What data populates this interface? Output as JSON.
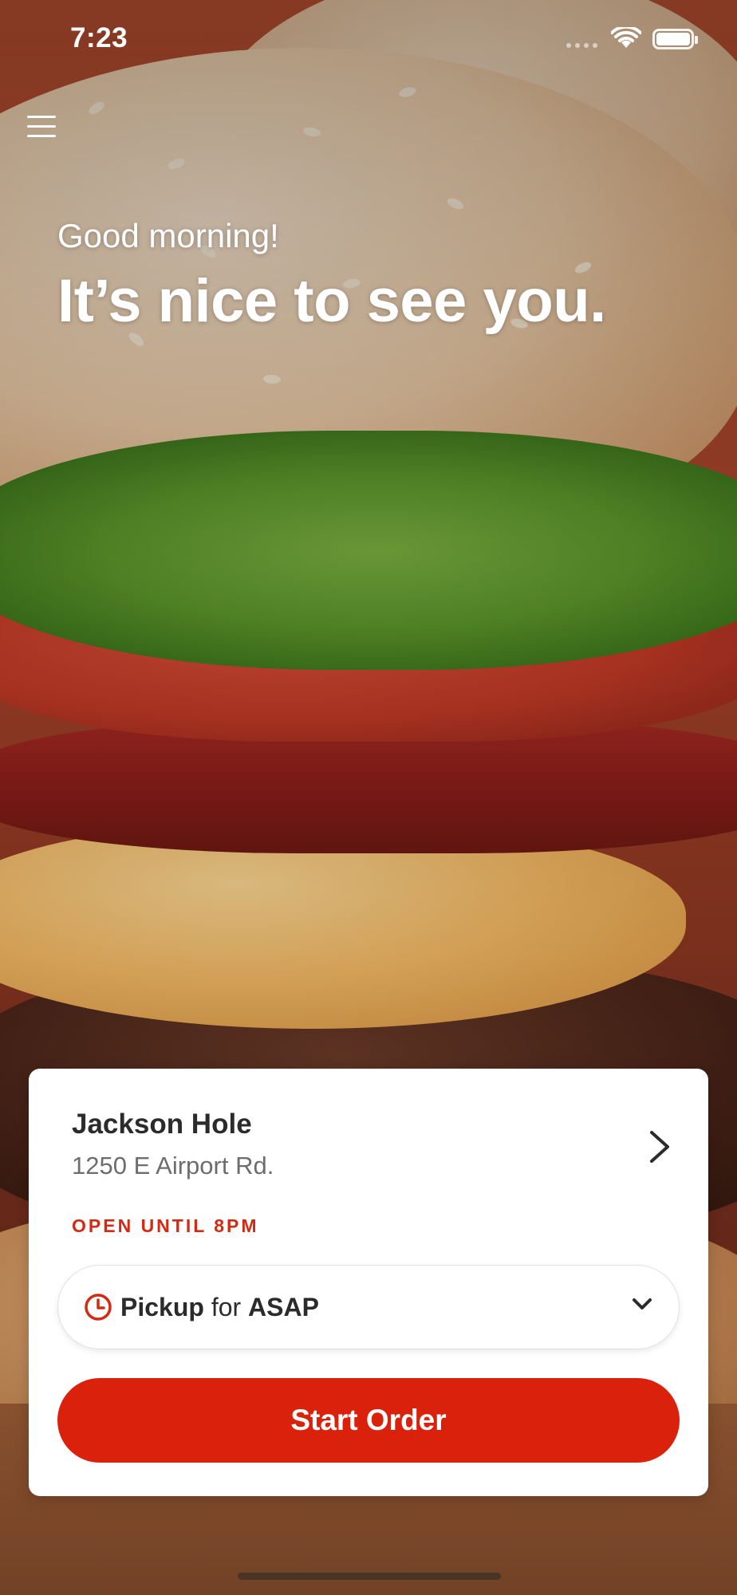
{
  "status_bar": {
    "time": "7:23",
    "icons": [
      "signal-icon",
      "wifi-icon",
      "battery-icon"
    ]
  },
  "menu": {
    "icon": "hamburger-menu-icon"
  },
  "greeting": {
    "subtitle": "Good morning!",
    "title": "It’s nice to see you."
  },
  "store": {
    "name": "Jackson Hole",
    "address": "1250 E Airport Rd.",
    "hours": "OPEN UNTIL 8PM",
    "chevron_icon": "chevron-right-icon"
  },
  "order_mode": {
    "icon": "clock-icon",
    "mode": "Pickup",
    "connector": "for",
    "time": "ASAP",
    "dropdown_icon": "chevron-down-icon"
  },
  "actions": {
    "start_order_label": "Start Order"
  },
  "colors": {
    "accent": "#d9210c",
    "hours_text": "#d42a13",
    "card_bg": "#ffffff",
    "text_primary": "#2b2b2b",
    "text_secondary": "#6d6d6d"
  }
}
